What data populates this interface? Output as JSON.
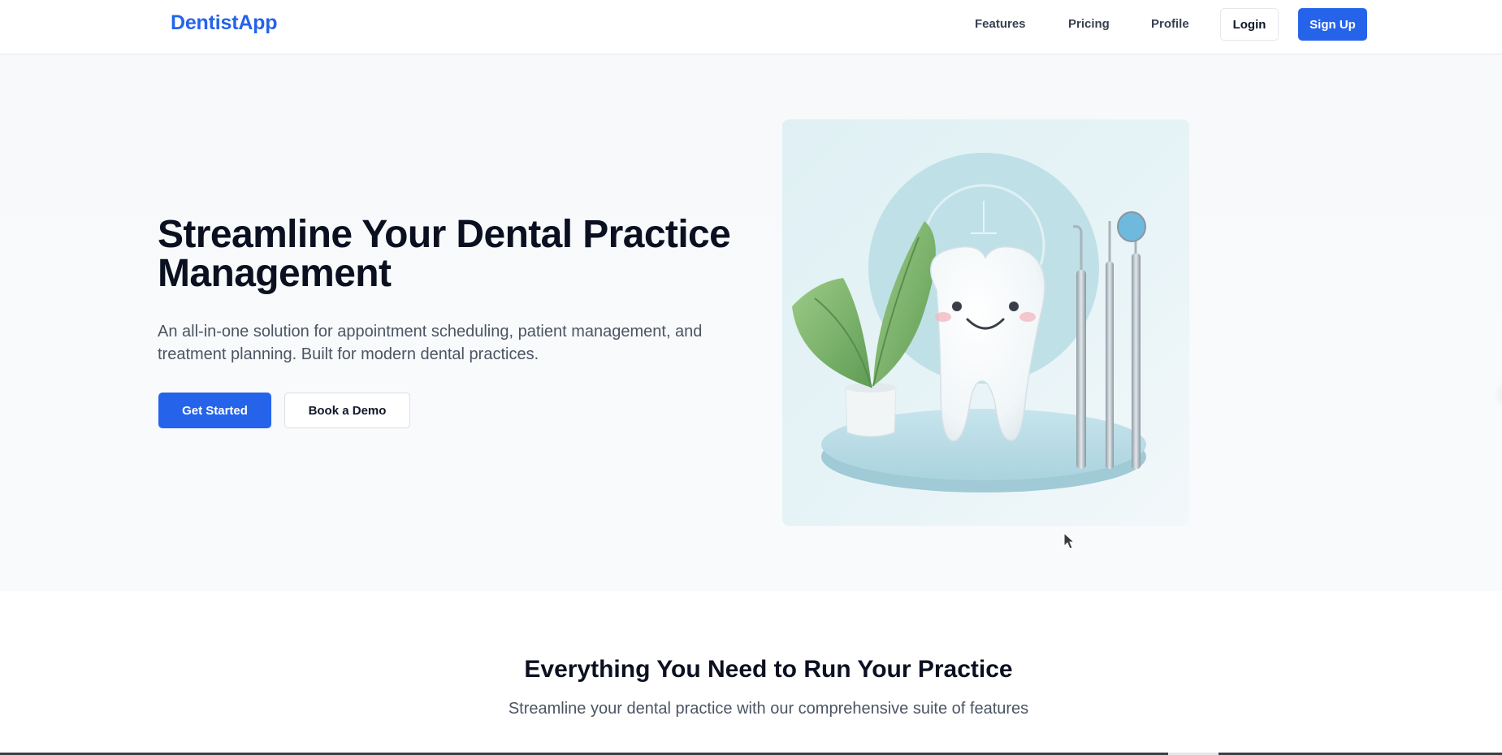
{
  "nav": {
    "brand": "DentistApp",
    "links": [
      "Features",
      "Pricing",
      "Profile"
    ],
    "login_label": "Login",
    "signup_label": "Sign Up"
  },
  "hero": {
    "title": "Streamline Your Dental Practice Management",
    "description": "An all-in-one solution for appointment scheduling, patient management, and treatment planning. Built for modern dental practices.",
    "primary_cta": "Get Started",
    "secondary_cta": "Book a Demo",
    "image_icon": "tooth-illustration-icon"
  },
  "features": {
    "title": "Everything You Need to Run Your Practice",
    "subtitle": "Streamline your dental practice with our comprehensive suite of features"
  },
  "colors": {
    "brand": "#2563eb",
    "hero_background": "#f8fafc",
    "text_dark": "#0b1021",
    "text_muted": "#4b5563"
  }
}
